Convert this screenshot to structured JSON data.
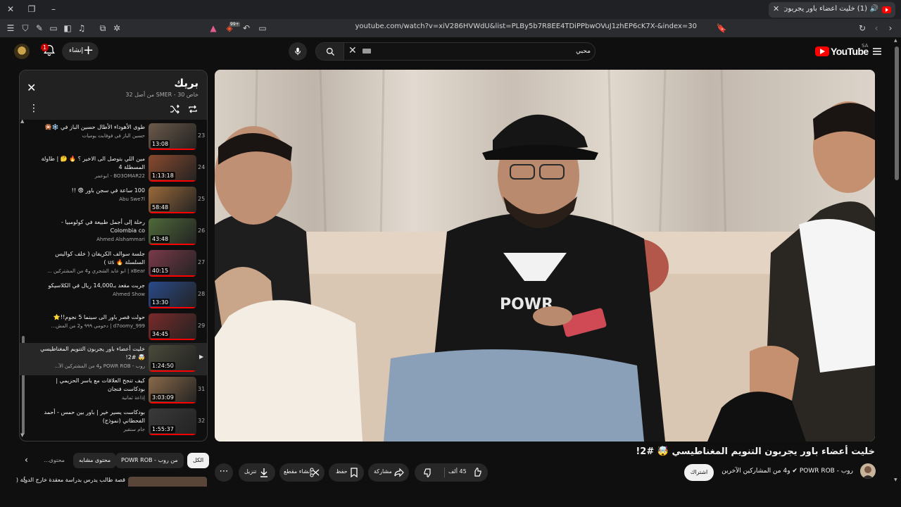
{
  "browser": {
    "tab_title": "(1) خليت أعضاء باور يجربون التن...",
    "url": "youtube.com/watch?v=xiV286HVWdU&list=PLBy5b7R8EE4TDiPPbwOVuJ1zhEP6cK7X-&index=30",
    "shield_badge": "99+"
  },
  "masthead": {
    "notifications_count": "1",
    "create_label": "إنشاء",
    "search_value": "محبي",
    "logo_text": "YouTube",
    "country_code": "SA"
  },
  "playlist": {
    "title": "بريك",
    "meta": "خاص SMER - 30 من أصل 32",
    "items": [
      {
        "index": "23",
        "title": "طوى الأهوداء الأطال حسين الباز في ❄️🎇",
        "channel": "حسين الباز في فوفابت يوميات",
        "duration": "13:08",
        "thumb": "#6b5a4a"
      },
      {
        "index": "24",
        "title": "مين اللي بتوصل الى الاخير ؟ 🔥 🤔 | طاولة المسطلة 4",
        "channel": "BO3OMAR22 - ابوعمر",
        "duration": "1:13:18",
        "thumb": "#8a4a2e"
      },
      {
        "index": "25",
        "title": "100 ساعة في سجن باور 😨 !!",
        "channel": "Abu Swe7l",
        "duration": "58:48",
        "thumb": "#9b6a3a"
      },
      {
        "index": "26",
        "title": "رحلة إلى أجمل طبيعة في كولومبيا - Colombia co",
        "channel": "Ahmed Alshammari",
        "duration": "43:48",
        "thumb": "#4f6a3a"
      },
      {
        "index": "27",
        "title": "جلسة سوالف الكريفان ( خلف كواليس السلسلة 🔥 us )",
        "channel": "xBear | ابو عابد الشجري و4 من المشتركين ...",
        "duration": "40:15",
        "thumb": "#7a3a4a"
      },
      {
        "index": "28",
        "title": "جربت مقعد بـ14,000 ريال في الكلاسيكو",
        "channel": "Ahmed Show",
        "duration": "13:30",
        "thumb": "#2a4a8a"
      },
      {
        "index": "29",
        "title": "حولت قصر باور الى سينما 5 نجوم!!⭐",
        "channel": "d7oomy_999 | دحومي ٩٩٩ و2 من المش...",
        "duration": "34:45",
        "thumb": "#7a2a2a"
      },
      {
        "index": "30",
        "title": "خليت أعضاء باور يجربون التنويم المغناطيسي 🤯 #2!",
        "channel": "روب - POWR ROB و4 من المشتركين الآ...",
        "duration": "1:24:50",
        "thumb": "#4a4a3a",
        "current": true
      },
      {
        "index": "31",
        "title": "كيف تنجح العلاقات مع ياسر الحزيمي | بودكاست فنجان",
        "channel": "إذاعة ثمانية",
        "duration": "3:03:09",
        "thumb": "#8a6a4a"
      },
      {
        "index": "32",
        "title": "بودكاست يسير خير | باور بين حمس - أحمد الفحطاني (نموذج)",
        "channel": "جام سنقير",
        "duration": "1:55:37",
        "thumb": "#3a3a3a"
      }
    ]
  },
  "chips": [
    "الكل",
    "من روب - POWR ROB",
    "محتوى مشابه",
    "محتوى..."
  ],
  "related_next": {
    "title": "قصة طالب يدرس بدراسة معقدة خارج الدولة ("
  },
  "video": {
    "title": "خليت أعضاء باور يجربون التنويم المغناطيسي 🤯 #2!",
    "channel_line": "روب - POWR ROB ✔ و4 من المشاركين الآخرين",
    "subscribe_label": "اشتراك",
    "likes": "45 ألف",
    "share_label": "مشاركة",
    "save_label": "حفظ",
    "clip_label": "إنشاء مقطع",
    "download_label": "تنزيل"
  },
  "colors": {
    "accent": "#ff0000",
    "bg": "#0f0f0f",
    "chip": "#272727"
  }
}
